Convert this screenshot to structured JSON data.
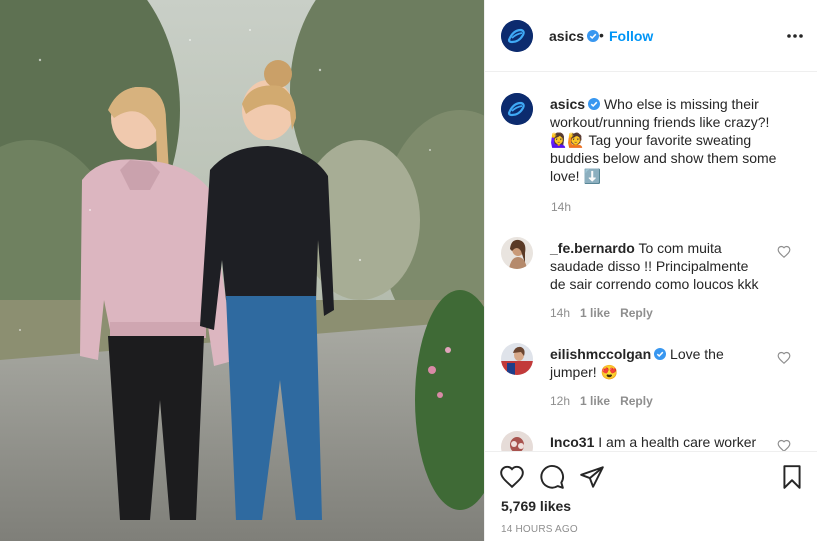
{
  "post": {
    "username": "asics",
    "follow_label": "Follow",
    "separator": "•",
    "caption_text": "Who else is missing their workout/running friends like crazy?! 🙋‍♀️🙋 Tag your favorite sweating buddies below and show them some love! ⬇️",
    "caption_time": "14h"
  },
  "comments": [
    {
      "username": "_fe.bernardo",
      "text": "To com muita saudade disso !! Principalmente de sair correndo como loucos kkk",
      "time": "14h",
      "likes": "1 like",
      "reply_label": "Reply"
    },
    {
      "username": "eilishmccolgan",
      "text": "Love the jumper! 😍",
      "time": "12h",
      "likes": "1 like",
      "reply_label": "Reply"
    },
    {
      "username": "Inco31",
      "text": "I am a health care worker"
    }
  ],
  "footer": {
    "likes": "5,769 likes",
    "time_ago": "14 HOURS AGO"
  },
  "icons": {
    "like": "heart-icon",
    "comment": "comment-bubble-icon",
    "share": "paper-plane-icon",
    "save": "bookmark-icon",
    "more": "more-horizontal-icon",
    "verified": "verified-badge-icon"
  },
  "colors": {
    "link_blue": "#0095f6",
    "verified_blue": "#3897f0",
    "brand_navy": "#0c2b6e",
    "muted_text": "#8e8e8e"
  }
}
